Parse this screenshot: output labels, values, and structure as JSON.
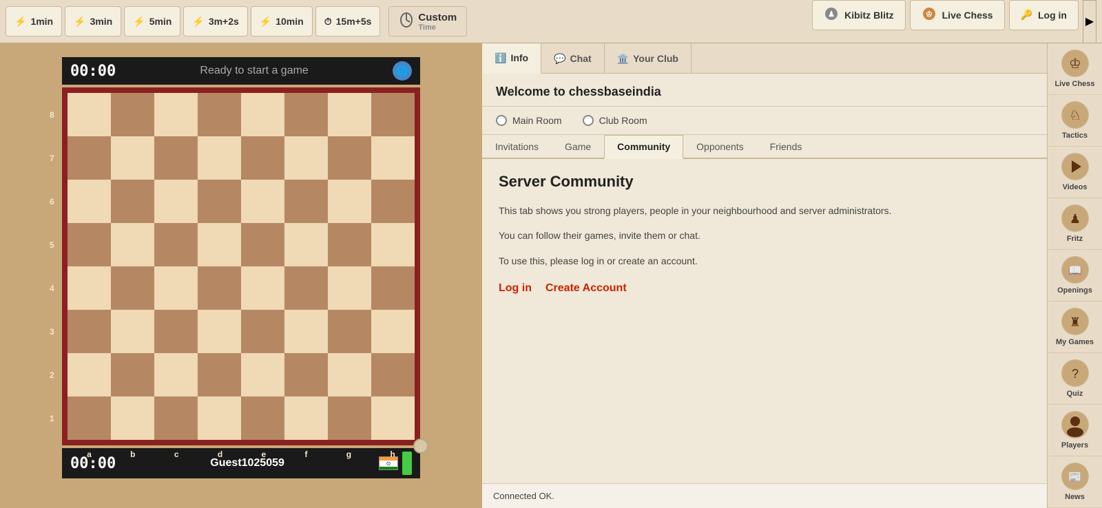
{
  "toolbar": {
    "scrollbar_label": "▲",
    "time_buttons": [
      {
        "label": "1min",
        "icon": "⚡"
      },
      {
        "label": "3min",
        "icon": "⚡"
      },
      {
        "label": "5min",
        "icon": "⚡"
      },
      {
        "label": "3m+2s",
        "icon": "⚡"
      },
      {
        "label": "10min",
        "icon": "⚡"
      },
      {
        "label": "15m+5s",
        "icon": "⏱"
      }
    ],
    "custom_label": "Custom",
    "custom_sublabel": "Time",
    "kibitz_label": "Kibitz Blitz",
    "livechess_label": "Live Chess",
    "login_label": "Log in"
  },
  "board": {
    "top_timer": "00:00",
    "top_status": "Ready to start a game",
    "bottom_timer": "00:00",
    "bottom_player": "Guest1025059",
    "rank_labels": [
      "8",
      "7",
      "6",
      "5",
      "4",
      "3",
      "2",
      "1"
    ],
    "file_labels": [
      "a",
      "b",
      "c",
      "d",
      "e",
      "f",
      "g",
      "h"
    ]
  },
  "info_panel": {
    "tabs": [
      {
        "label": "Info",
        "icon": "ℹ"
      },
      {
        "label": "Chat",
        "icon": "💬"
      },
      {
        "label": "Your Club",
        "icon": "🏛"
      }
    ],
    "welcome_title": "Welcome to chessbaseindia",
    "rooms": [
      {
        "label": "Main Room"
      },
      {
        "label": "Club Room"
      }
    ],
    "sub_tabs": [
      {
        "label": "Invitations"
      },
      {
        "label": "Game"
      },
      {
        "label": "Community"
      },
      {
        "label": "Opponents"
      },
      {
        "label": "Friends"
      }
    ],
    "community": {
      "title": "Server Community",
      "text1": "This tab shows you strong players, people in your neighbourhood and server administrators.",
      "text2": "You can follow their games, invite them or chat.",
      "text3": "To use this, please log in or create an account.",
      "login_link": "Log in",
      "create_account_link": "Create Account"
    },
    "status_bar": "Connected OK."
  },
  "sidebar": {
    "items": [
      {
        "label": "Live Chess",
        "icon": "♔"
      },
      {
        "label": "Tactics",
        "icon": "♘"
      },
      {
        "label": "Videos",
        "icon": "▶"
      },
      {
        "label": "Fritz",
        "icon": "♟"
      },
      {
        "label": "Openings",
        "icon": "📖"
      },
      {
        "label": "My Games",
        "icon": "♜"
      },
      {
        "label": "Quiz",
        "icon": "?"
      },
      {
        "label": "Players",
        "icon": "👤"
      },
      {
        "label": "News",
        "icon": "📰"
      }
    ]
  }
}
